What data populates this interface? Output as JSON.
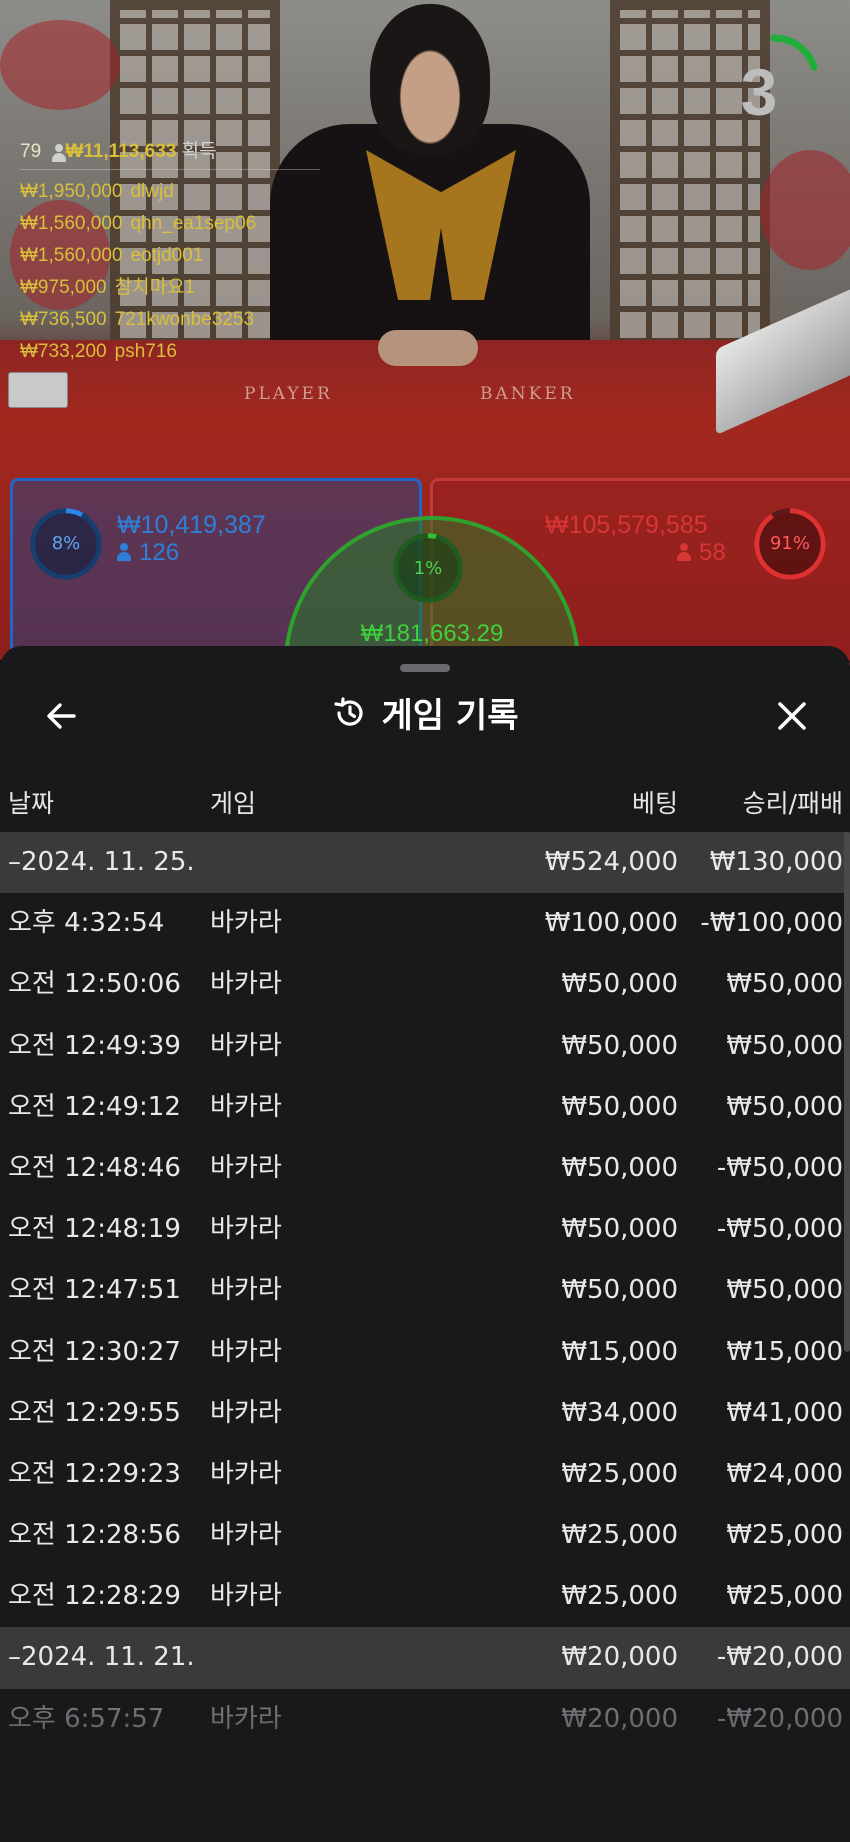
{
  "video": {
    "felt_player": "PLAYER",
    "felt_banker": "BANKER",
    "countdown": "3",
    "countdown_fraction": 0.2,
    "colors": {
      "player": "#1e67c5",
      "banker": "#c23a3a",
      "tie": "#2ea12e",
      "gold": "#d9bf3a"
    }
  },
  "winners": {
    "count": "79",
    "total": "₩11,113,633",
    "total_label": "획득",
    "list": [
      {
        "amount": "₩1,950,000",
        "user": "dlwjd"
      },
      {
        "amount": "₩1,560,000",
        "user": "qhn_ea1sep06"
      },
      {
        "amount": "₩1,560,000",
        "user": "eotjd001"
      },
      {
        "amount": "₩975,000",
        "user": "참치마요1"
      },
      {
        "amount": "₩736,500",
        "user": "721kwonbe3253"
      },
      {
        "amount": "₩733,200",
        "user": "psh716"
      }
    ]
  },
  "bets": {
    "player": {
      "percent": "8%",
      "percent_value": 8,
      "amount": "₩10,419,387",
      "players": "126"
    },
    "banker": {
      "percent": "91%",
      "percent_value": 91,
      "amount": "₩105,579,585",
      "players": "58"
    },
    "tie": {
      "percent": "1%",
      "percent_value": 1,
      "amount": "₩181,663.29"
    }
  },
  "history": {
    "title": "게임 기록",
    "icons": {
      "back": "back-arrow-icon",
      "title": "history-icon",
      "close": "close-icon"
    },
    "columns": {
      "date": "날짜",
      "game": "게임",
      "bet": "베팅",
      "result": "승리/패배"
    },
    "rows": [
      {
        "type": "group",
        "date": "–2024. 11. 25.",
        "game": "",
        "bet": "₩524,000",
        "result": "₩130,000"
      },
      {
        "type": "item",
        "date": "오후 4:32:54",
        "game": "바카라",
        "bet": "₩100,000",
        "result": "-₩100,000"
      },
      {
        "type": "item",
        "date": "오전 12:50:06",
        "game": "바카라",
        "bet": "₩50,000",
        "result": "₩50,000"
      },
      {
        "type": "item",
        "date": "오전 12:49:39",
        "game": "바카라",
        "bet": "₩50,000",
        "result": "₩50,000"
      },
      {
        "type": "item",
        "date": "오전 12:49:12",
        "game": "바카라",
        "bet": "₩50,000",
        "result": "₩50,000"
      },
      {
        "type": "item",
        "date": "오전 12:48:46",
        "game": "바카라",
        "bet": "₩50,000",
        "result": "-₩50,000"
      },
      {
        "type": "item",
        "date": "오전 12:48:19",
        "game": "바카라",
        "bet": "₩50,000",
        "result": "-₩50,000"
      },
      {
        "type": "item",
        "date": "오전 12:47:51",
        "game": "바카라",
        "bet": "₩50,000",
        "result": "₩50,000"
      },
      {
        "type": "item",
        "date": "오전 12:30:27",
        "game": "바카라",
        "bet": "₩15,000",
        "result": "₩15,000"
      },
      {
        "type": "item",
        "date": "오전 12:29:55",
        "game": "바카라",
        "bet": "₩34,000",
        "result": "₩41,000"
      },
      {
        "type": "item",
        "date": "오전 12:29:23",
        "game": "바카라",
        "bet": "₩25,000",
        "result": "₩24,000"
      },
      {
        "type": "item",
        "date": "오전 12:28:56",
        "game": "바카라",
        "bet": "₩25,000",
        "result": "₩25,000"
      },
      {
        "type": "item",
        "date": "오전 12:28:29",
        "game": "바카라",
        "bet": "₩25,000",
        "result": "₩25,000"
      },
      {
        "type": "group",
        "date": "–2024. 11. 21.",
        "game": "",
        "bet": "₩20,000",
        "result": "-₩20,000"
      },
      {
        "type": "item",
        "date": "오후 6:57:57",
        "game": "바카라",
        "bet": "₩20,000",
        "result": "-₩20,000"
      }
    ]
  }
}
